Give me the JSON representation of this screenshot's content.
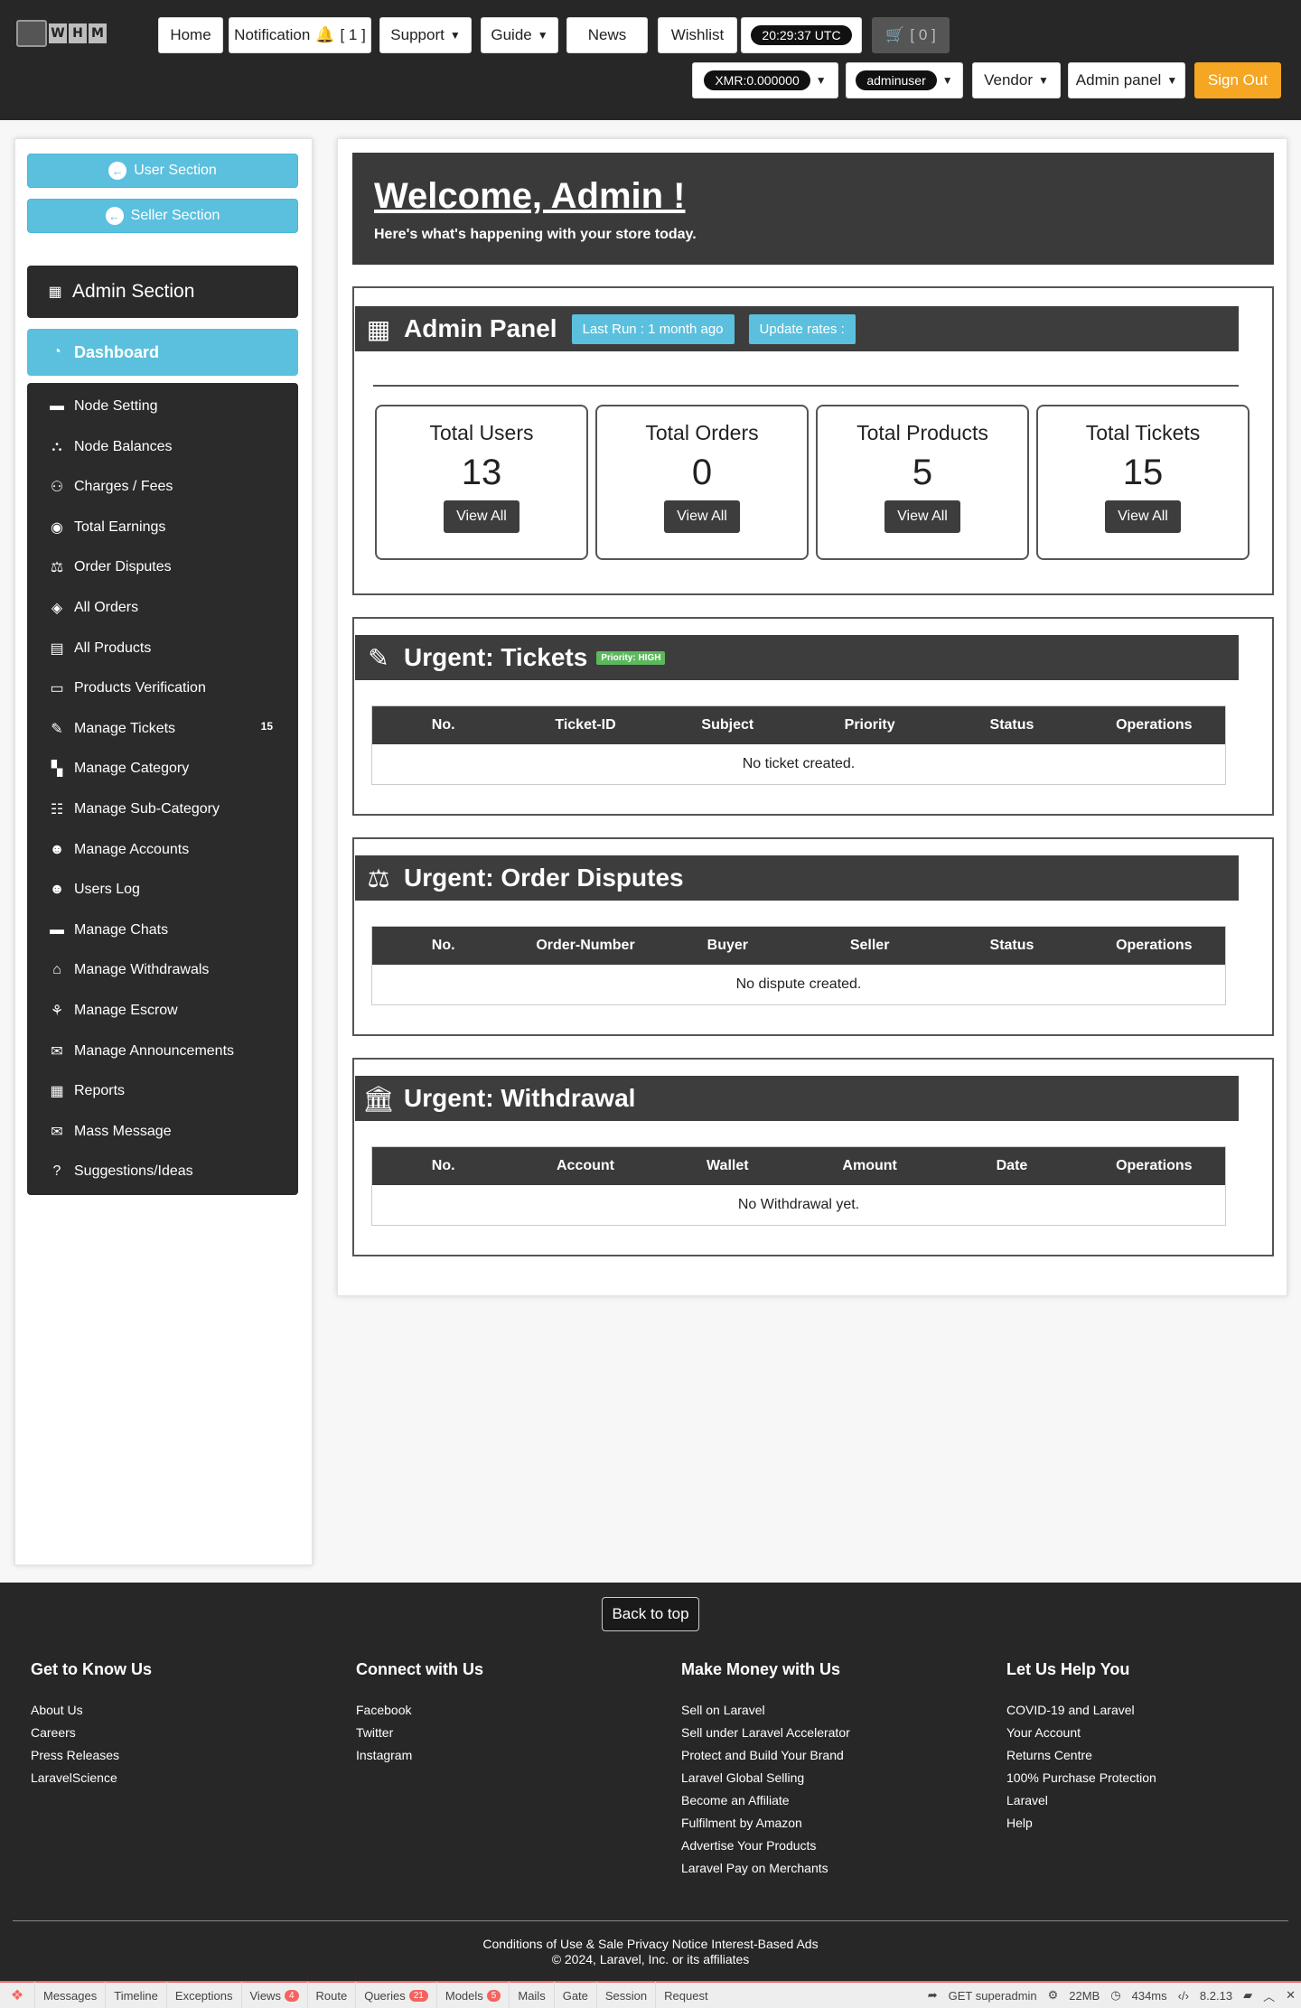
{
  "nav": {
    "logo_letters": [
      "W",
      "H",
      "M"
    ],
    "home": "Home",
    "notification": "Notification",
    "notification_count": "[ 1 ]",
    "support": "Support",
    "guide": "Guide",
    "news": "News",
    "wishlist": "Wishlist",
    "time": "20:29:37 UTC",
    "cart": "[ 0 ]",
    "balance": "XMR:0.000000",
    "username": "adminuser",
    "vendor": "Vendor",
    "admin_panel": "Admin panel",
    "sign_out": "Sign Out"
  },
  "sidebar": {
    "user_section": "User Section",
    "seller_section": "Seller Section",
    "admin_section": "Admin Section",
    "items": [
      {
        "label": "Dashboard",
        "icon": "dashboard-icon"
      },
      {
        "label": "Node Setting",
        "icon": "wallet-icon"
      },
      {
        "label": "Node Balances",
        "icon": "network-icon"
      },
      {
        "label": "Charges / Fees",
        "icon": "charges-icon"
      },
      {
        "label": "Total Earnings",
        "icon": "earnings-icon"
      },
      {
        "label": "Order Disputes",
        "icon": "disputes-icon"
      },
      {
        "label": "All Orders",
        "icon": "box-icon"
      },
      {
        "label": "All Products",
        "icon": "products-icon"
      },
      {
        "label": "Products Verification",
        "icon": "verify-icon"
      },
      {
        "label": "Manage Tickets",
        "icon": "ticket-icon",
        "badge": "15"
      },
      {
        "label": "Manage Category",
        "icon": "category-icon"
      },
      {
        "label": "Manage Sub-Category",
        "icon": "subcategory-icon"
      },
      {
        "label": "Manage Accounts",
        "icon": "accounts-icon"
      },
      {
        "label": "Users Log",
        "icon": "userslog-icon"
      },
      {
        "label": "Manage Chats",
        "icon": "chat-icon"
      },
      {
        "label": "Manage Withdrawals",
        "icon": "withdraw-icon"
      },
      {
        "label": "Manage Escrow",
        "icon": "escrow-icon"
      },
      {
        "label": "Manage Announcements",
        "icon": "announce-icon"
      },
      {
        "label": "Reports",
        "icon": "reports-icon"
      },
      {
        "label": "Mass Message",
        "icon": "mail-icon"
      },
      {
        "label": "Suggestions/Ideas",
        "icon": "question-icon"
      }
    ]
  },
  "welcome": {
    "title": "Welcome, Admin !",
    "subtitle": "Here's what's happening with your store today."
  },
  "admin_panel": {
    "title": "Admin Panel",
    "last_run": "Last Run : 1 month ago",
    "update_rates": "Update rates :",
    "stats": [
      {
        "label": "Total Users",
        "value": "13",
        "button": "View All"
      },
      {
        "label": "Total Orders",
        "value": "0",
        "button": "View All"
      },
      {
        "label": "Total Products",
        "value": "5",
        "button": "View All"
      },
      {
        "label": "Total Tickets",
        "value": "15",
        "button": "View All"
      }
    ]
  },
  "tickets": {
    "title": "Urgent: Tickets",
    "priority": "Priority: HIGH",
    "columns": [
      "No.",
      "Ticket-ID",
      "Subject",
      "Priority",
      "Status",
      "Operations"
    ],
    "empty": "No ticket created."
  },
  "disputes": {
    "title": "Urgent: Order Disputes",
    "columns": [
      "No.",
      "Order-Number",
      "Buyer",
      "Seller",
      "Status",
      "Operations"
    ],
    "empty": "No dispute created."
  },
  "withdrawal": {
    "title": "Urgent: Withdrawal",
    "columns": [
      "No.",
      "Account",
      "Wallet",
      "Amount",
      "Date",
      "Operations"
    ],
    "empty": "No Withdrawal yet."
  },
  "footer": {
    "back_to_top": "Back to top",
    "columns": [
      {
        "title": "Get to Know Us",
        "links": [
          "About Us",
          "Careers",
          "Press Releases",
          "LaravelScience"
        ]
      },
      {
        "title": "Connect with Us",
        "links": [
          "Facebook",
          "Twitter",
          "Instagram"
        ]
      },
      {
        "title": "Make Money with Us",
        "links": [
          "Sell on Laravel",
          "Sell under Laravel Accelerator",
          "Protect and Build Your Brand",
          "Laravel Global Selling",
          "Become an Affiliate",
          "Fulfilment by Amazon",
          "Advertise Your Products",
          "Laravel Pay on Merchants"
        ]
      },
      {
        "title": "Let Us Help You",
        "links": [
          "COVID-19 and Laravel",
          "Your Account",
          "Returns Centre",
          "100% Purchase Protection",
          "Laravel",
          "Help"
        ]
      }
    ],
    "legal_line1": "Conditions of Use & Sale Privacy Notice Interest-Based Ads",
    "legal_line2": "© 2024, Laravel, Inc. or its affiliates"
  },
  "debugbar": {
    "tabs": [
      {
        "label": "Messages"
      },
      {
        "label": "Timeline"
      },
      {
        "label": "Exceptions"
      },
      {
        "label": "Views",
        "count": "4"
      },
      {
        "label": "Route"
      },
      {
        "label": "Queries",
        "count": "21"
      },
      {
        "label": "Models",
        "count": "5"
      },
      {
        "label": "Mails"
      },
      {
        "label": "Gate"
      },
      {
        "label": "Session"
      },
      {
        "label": "Request"
      }
    ],
    "request": "GET superadmin",
    "memory": "22MB",
    "duration": "434ms",
    "php": "8.2.13"
  },
  "colors": {
    "navbar": "#272727",
    "info": "#5bc0de",
    "warning": "#f5a623",
    "success": "#5cb85c",
    "dark_panel": "#3d3d3d"
  }
}
